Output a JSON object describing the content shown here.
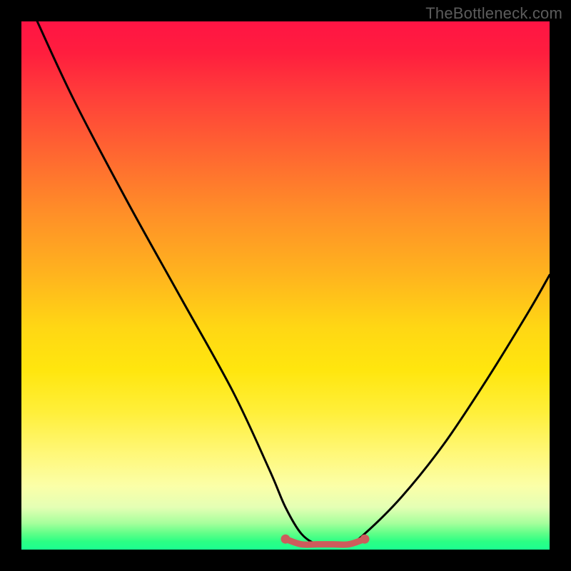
{
  "watermark": "TheBottleneck.com",
  "chart_data": {
    "type": "line",
    "title": "",
    "xlabel": "",
    "ylabel": "",
    "xlim": [
      0,
      100
    ],
    "ylim": [
      0,
      100
    ],
    "series": [
      {
        "name": "black-curve",
        "x": [
          3,
          10,
          20,
          30,
          40,
          47,
          50,
          53,
          56,
          59,
          62,
          65,
          72,
          80,
          88,
          96,
          100
        ],
        "values": [
          100,
          85,
          66,
          48,
          30,
          15,
          8,
          3,
          1,
          1,
          1,
          3,
          10,
          20,
          32,
          45,
          52
        ]
      },
      {
        "name": "flat-red-segment",
        "x": [
          50,
          53,
          56,
          59,
          62,
          65
        ],
        "values": [
          2,
          1,
          1,
          1,
          1,
          2
        ]
      }
    ],
    "colors": {
      "black_curve": "#000000",
      "flat_segment": "#cd5c5c",
      "gradient_top": "#ff1444",
      "gradient_bottom": "#1cff90"
    },
    "annotations": []
  }
}
